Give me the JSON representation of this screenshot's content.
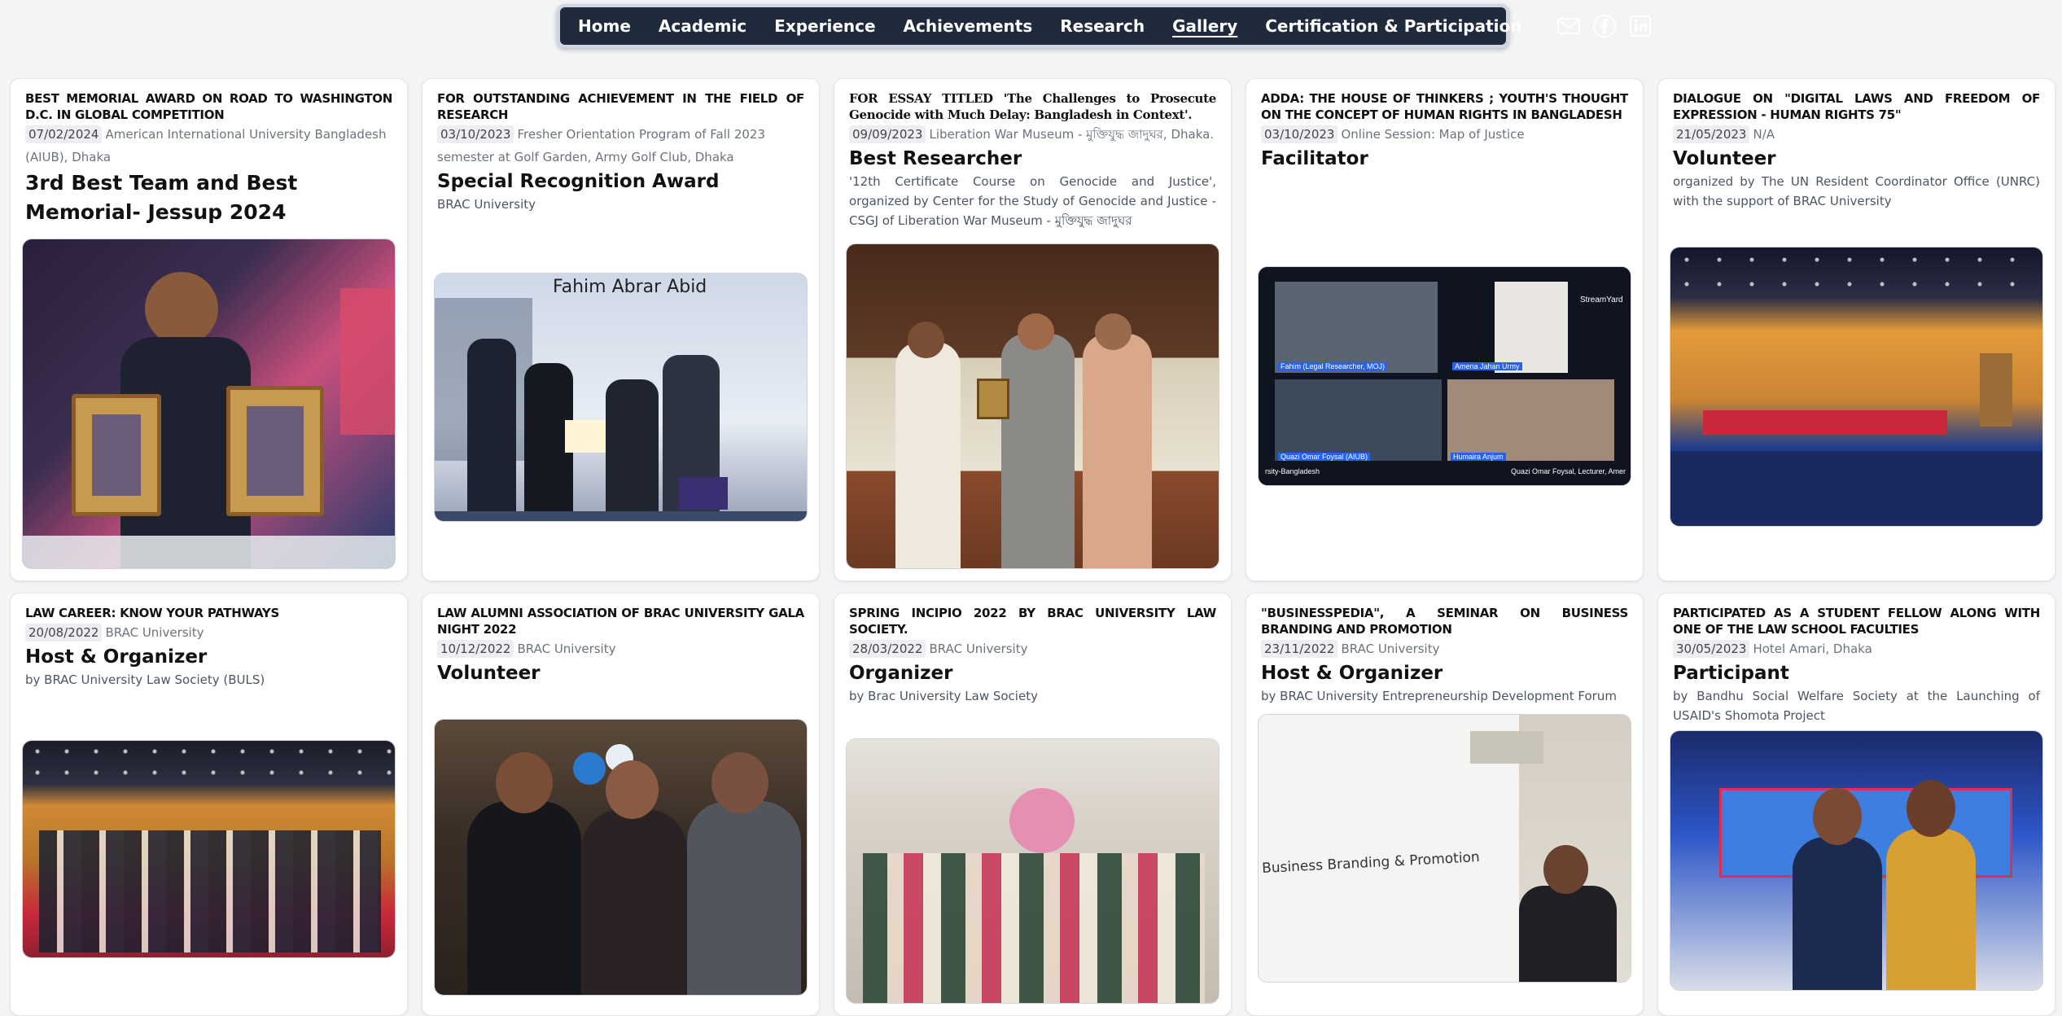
{
  "nav": {
    "items": [
      "Home",
      "Academic",
      "Experience",
      "Achievements",
      "Research",
      "Gallery",
      "Certification & Participation"
    ],
    "active": "Gallery",
    "icons": [
      "mail-icon",
      "facebook-icon",
      "linkedin-icon"
    ]
  },
  "cards": [
    {
      "kicker": "BEST MEMORIAL AWARD ON ROAD TO WASHINGTON D.C. IN GLOBAL COMPETITION",
      "date": "07/02/2024",
      "place": "American International University Bangladesh (AIUB), Dhaka",
      "title": "3rd Best Team and Best Memorial- Jessup 2024",
      "desc": ""
    },
    {
      "kicker": "FOR OUTSTANDING ACHIEVEMENT IN THE FIELD OF RESEARCH",
      "date": "03/10/2023",
      "place": "Fresher Orientation Program of Fall 2023 semester at Golf Garden, Army Golf Club, Dhaka",
      "title": "Special Recognition Award",
      "desc": "BRAC University",
      "photo_caption": "Fahim Abrar Abid"
    },
    {
      "kicker": "FOR ESSAY TITLED 'The Challenges to Prosecute Genocide with Much Delay: Bangladesh in Context'.",
      "date": "09/09/2023",
      "place": "Liberation War Museum - মুক্তিযুদ্ধ জাদুঘর, Dhaka.",
      "title": "Best Researcher",
      "desc": "'12th Certificate Course on Genocide and Justice', organized by Center for the Study of Genocide and Justice - CSGJ of Liberation War Museum - মুক্তিযুদ্ধ জাদুঘর"
    },
    {
      "kicker": "ADDA: THE HOUSE OF THINKERS ; YOUTH'S THOUGHT ON THE CONCEPT OF HUMAN RIGHTS IN BANGLADESH",
      "date": "03/10/2023",
      "place": "Online Session: Map of Justice",
      "title": "Facilitator",
      "desc": ""
    },
    {
      "kicker": "DIALOGUE ON \"DIGITAL LAWS AND FREEDOM OF EXPRESSION - HUMAN RIGHTS 75\"",
      "date": "21/05/2023",
      "place": "N/A",
      "title": "Volunteer",
      "desc": "organized by The UN Resident Coordinator Office (UNRC) with the support of BRAC University"
    },
    {
      "kicker": "LAW CAREER: KNOW YOUR PATHWAYS",
      "date": "20/08/2022",
      "place": "BRAC University",
      "title": "Host & Organizer",
      "desc": "by BRAC University Law Society (BULS)"
    },
    {
      "kicker": "LAW ALUMNI ASSOCIATION OF BRAC UNIVERSITY GALA NIGHT 2022",
      "date": "10/12/2022",
      "place": "BRAC University",
      "title": "Volunteer",
      "desc": ""
    },
    {
      "kicker": "SPRING INCIPIO 2022 BY BRAC UNIVERSITY LAW SOCIETY.",
      "date": "28/03/2022",
      "place": "BRAC University",
      "title": "Organizer",
      "desc": "by Brac University Law Society"
    },
    {
      "kicker": "\"BUSINESSPEDIA\", A SEMINAR ON BUSINESS BRANDING AND PROMOTION",
      "date": "23/11/2022",
      "place": "BRAC University",
      "title": "Host & Organizer",
      "desc": "by BRAC University Entrepreneurship Development Forum",
      "photo_caption": "Business Branding & Promotion"
    },
    {
      "kicker": "PARTICIPATED AS A STUDENT FELLOW ALONG WITH ONE OF THE LAW SCHOOL FACULTIES",
      "date": "30/05/2023",
      "place": "Hotel Amari, Dhaka",
      "title": "Participant",
      "desc": "by Bandhu Social Welfare Society at the Launching of USAID's Shomota Project"
    }
  ],
  "video_call": {
    "tiles": [
      "Fahim (Legal Researcher, MOJ)",
      "Amena Jahan Urmy",
      "Quazi Omar Foysal (AIUB)",
      "Humaira Anjum"
    ],
    "footer_left": "rsity-Bangladesh",
    "footer_right": "Quazi Omar Foysal, Lecturer, Amer",
    "brand": "StreamYard"
  }
}
